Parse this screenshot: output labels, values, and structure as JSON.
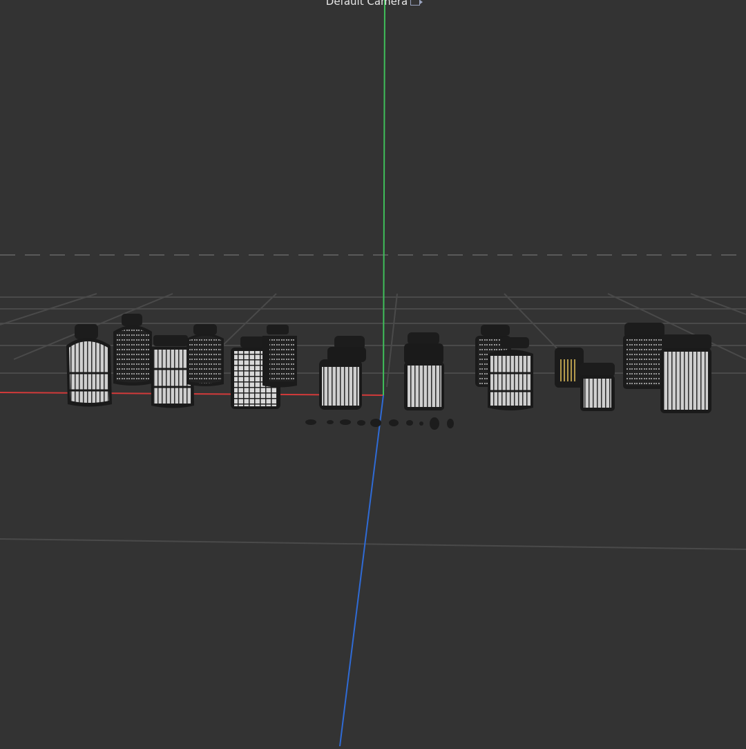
{
  "viewport": {
    "camera_label": "Default Camera",
    "camera_icon": "camera-icon",
    "background": "#333333",
    "grid_color": "#4a4a4a",
    "horizon_color": "#5a5a5a",
    "axis_colors": {
      "x": "#d23a3a",
      "y": "#3fbf5a",
      "z": "#2f6bd6"
    },
    "objects": [
      "bottle-model",
      "bottle-model",
      "bottle-model",
      "bottle-model",
      "jar-model",
      "jar-model",
      "jar-model",
      "jar-model",
      "jar-model",
      "jar-model",
      "jar-model",
      "jar-model",
      "jar-model",
      "jar-model",
      "jar-model",
      "jar-model"
    ]
  }
}
